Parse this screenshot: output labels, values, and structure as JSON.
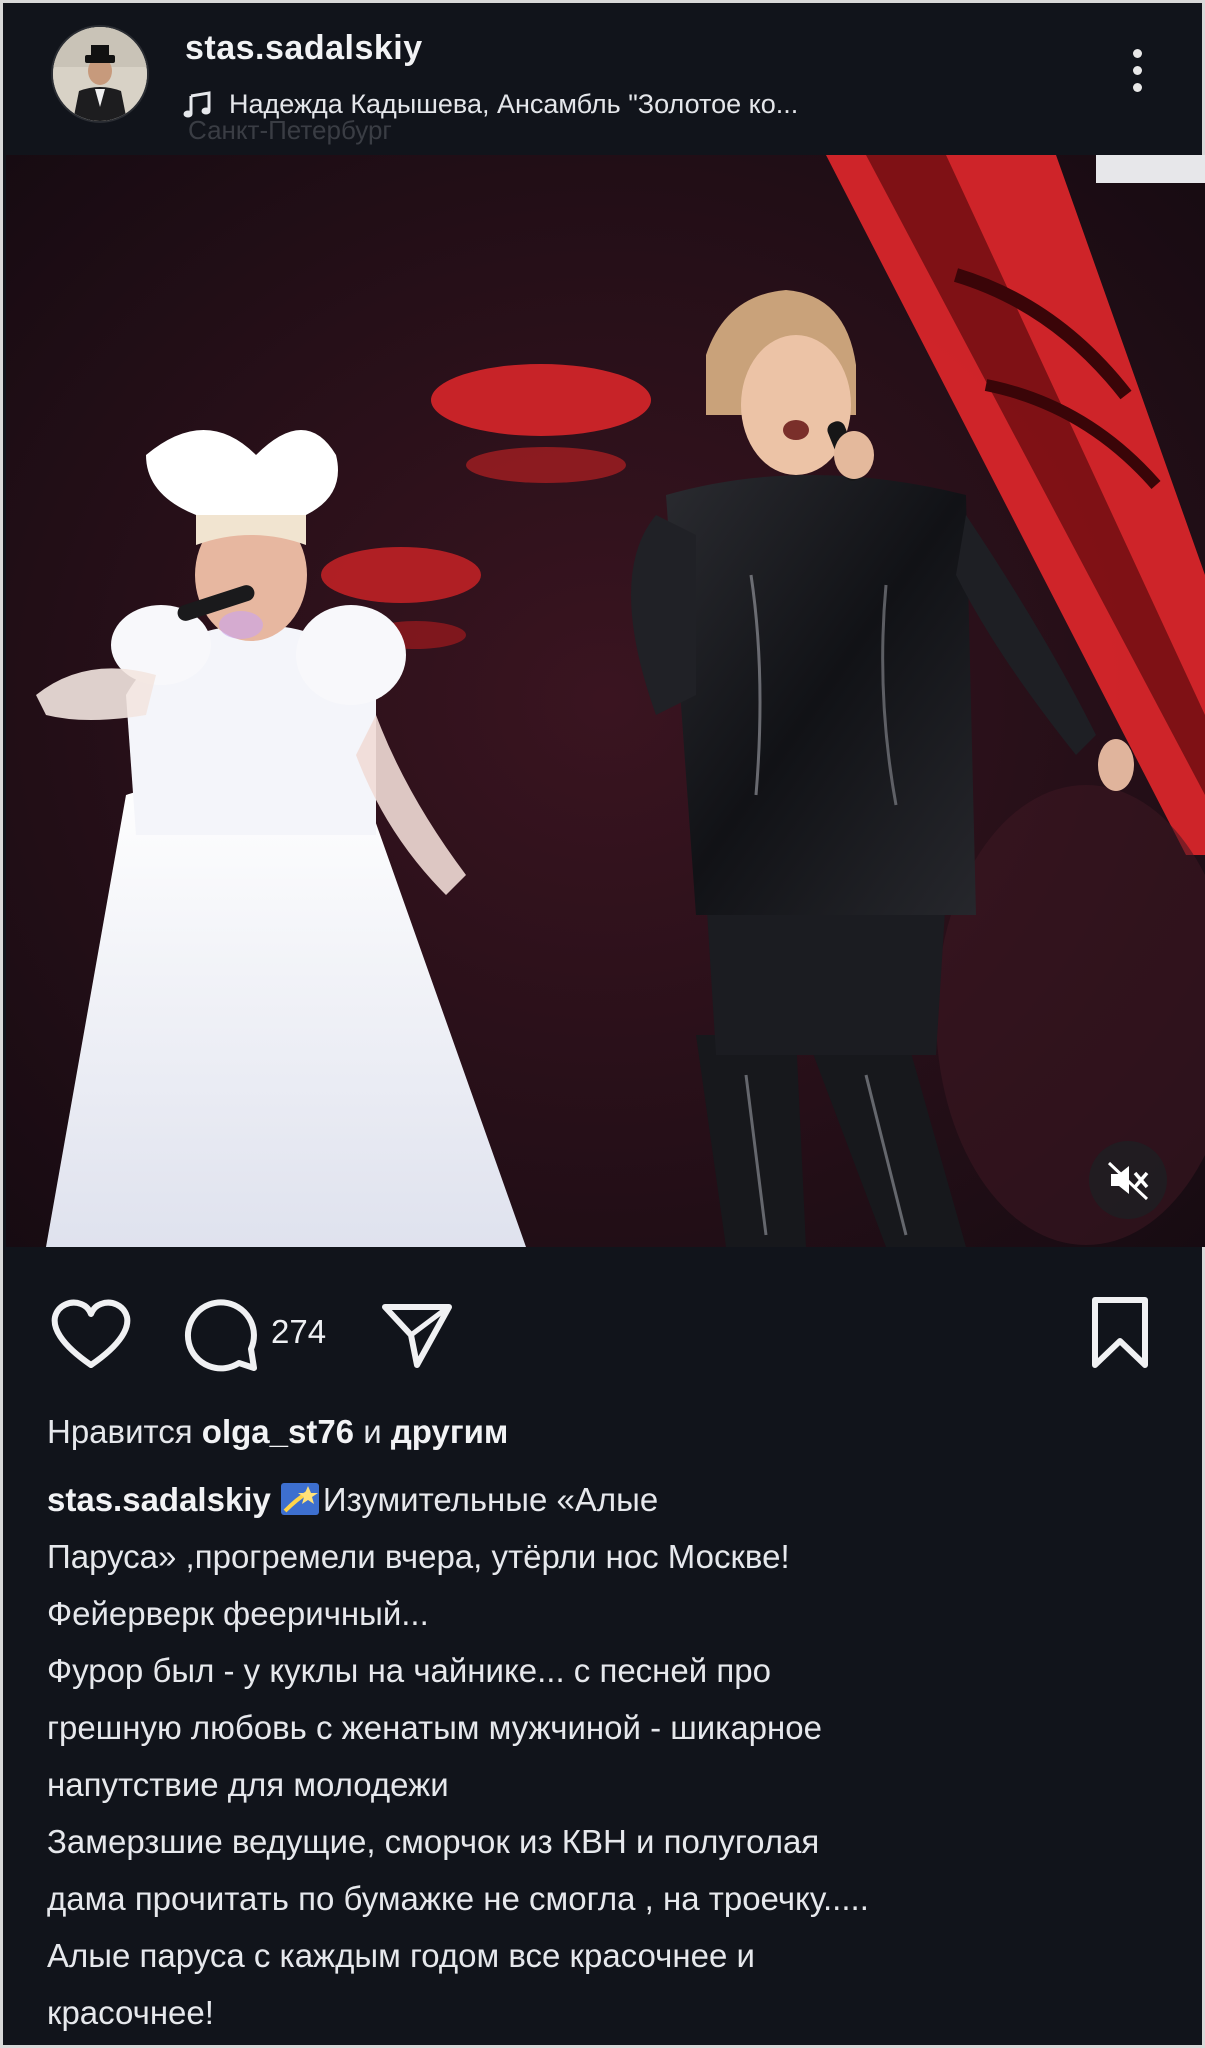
{
  "header": {
    "username": "stas.sadalskiy",
    "music_label": "Надежда Кадышева, Ансамбль \"Золотое ко...",
    "location_ghost": "Санкт-Петербург"
  },
  "media": {
    "description": "",
    "mute_icon": "speaker-muted-icon"
  },
  "actions": {
    "like_icon": "heart-icon",
    "comment_icon": "comment-icon",
    "comment_count": "274",
    "share_icon": "paper-plane-icon",
    "save_icon": "bookmark-icon"
  },
  "likes": {
    "prefix": "Нравится ",
    "user": "olga_st76",
    "mid": " и ",
    "suffix": "другим"
  },
  "caption": {
    "user": "stas.sadalskiy",
    "emoji": "shooting-star-emoji",
    "line1": "Изумительные «Алые",
    "line2": "Паруса» ,прогремели вчера, утёрли нос Москве!",
    "line3": "Фейерверк фееричный...",
    "line4": "Фурор был - у куклы на чайнике... с песней про",
    "line5": "грешную любовь с женатым мужчиной - шикарное",
    "line6": "напутствие для молодежи",
    "line7": "Замерзшие ведущие, сморчок из КВН и полуголая",
    "line8": "дама прочитать по бумажке не смогла , на троечку.....",
    "line9": "Алые паруса с каждым годом все красочнее и",
    "line10": "красочнее!"
  },
  "colors": {
    "background": "#11141b",
    "stage_red": "#d8262a",
    "text": "#e6e8ec"
  }
}
